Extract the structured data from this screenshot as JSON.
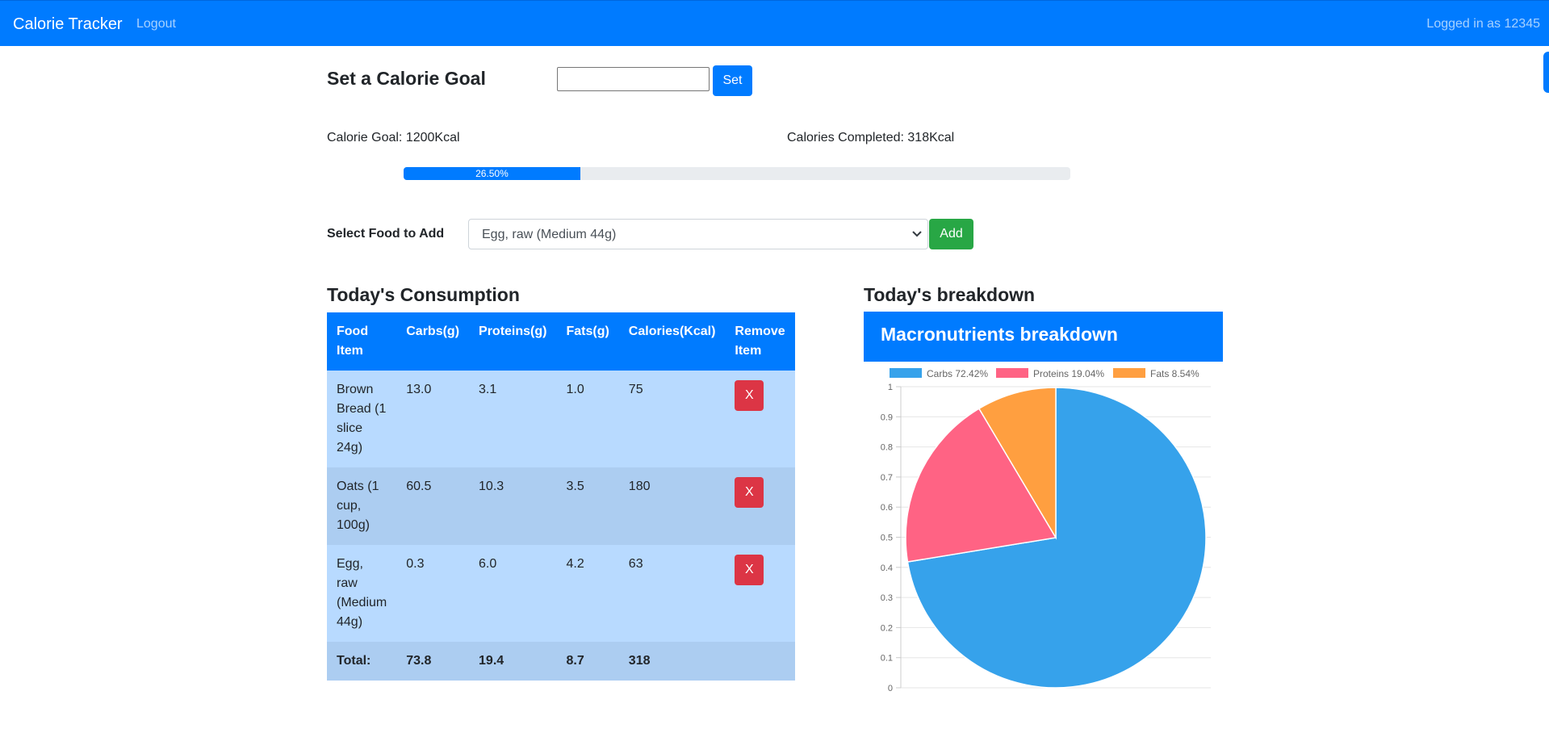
{
  "navbar": {
    "brand": "Calorie Tracker",
    "logout": "Logout",
    "user": "Logged in as 12345"
  },
  "goal": {
    "title": "Set a Calorie Goal",
    "input_value": "",
    "set_label": "Set",
    "goal_text": "Calorie Goal: 1200Kcal",
    "completed_text": "Calories Completed: 318Kcal",
    "progress_percent": 26.5,
    "progress_label": "26.50%"
  },
  "food_select": {
    "label": "Select Food to Add",
    "selected": "Egg, raw (Medium 44g)",
    "add_label": "Add"
  },
  "consumption": {
    "title": "Today's Consumption",
    "headers": [
      "Food Item",
      "Carbs(g)",
      "Proteins(g)",
      "Fats(g)",
      "Calories(Kcal)",
      "Remove Item"
    ],
    "rows": [
      [
        "Brown Bread (1 slice 24g)",
        "13.0",
        "3.1",
        "1.0",
        "75"
      ],
      [
        "Oats (1 cup, 100g)",
        "60.5",
        "10.3",
        "3.5",
        "180"
      ],
      [
        "Egg, raw (Medium 44g)",
        "0.3",
        "6.0",
        "4.2",
        "63"
      ]
    ],
    "remove_label": "X",
    "total": [
      "Total:",
      "73.8",
      "19.4",
      "8.7",
      "318"
    ]
  },
  "breakdown": {
    "title": "Today's breakdown",
    "card_title": "Macronutrients breakdown"
  },
  "colors": {
    "primary": "#007bff",
    "success": "#28a745",
    "danger": "#dc3545",
    "row_light": "#b8daff",
    "row_dark": "#accdf1"
  },
  "chart_data": {
    "type": "pie",
    "categories": [
      "Carbs",
      "Proteins",
      "Fats"
    ],
    "values": [
      72.42,
      19.04,
      8.54
    ],
    "legend": [
      "Carbs 72.42%",
      "Proteins 19.04%",
      "Fats 8.54%"
    ],
    "colors": [
      "#36a2eb",
      "#ff6384",
      "#ff9f40"
    ],
    "y_ticks": [
      "0",
      "0.1",
      "0.2",
      "0.3",
      "0.4",
      "0.5",
      "0.6",
      "0.7",
      "0.8",
      "0.9",
      "1"
    ],
    "legend_position": "top",
    "grid": true
  }
}
